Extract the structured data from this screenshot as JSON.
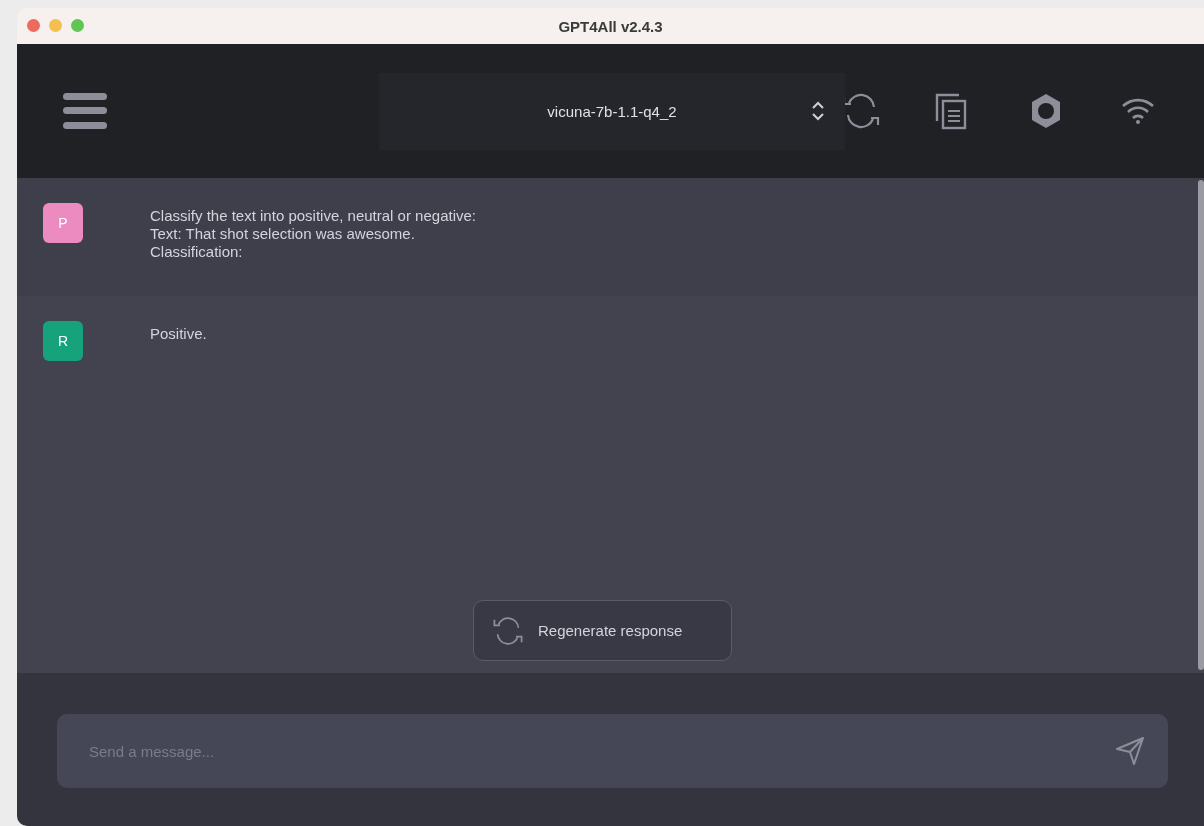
{
  "window": {
    "title": "GPT4All v2.4.3"
  },
  "toolbar": {
    "model": "vicuna-7b-1.1-q4_2"
  },
  "messages": [
    {
      "kind": "prompt",
      "avatar": "P",
      "color": "#ec8bbf",
      "text": "Classify the text into positive, neutral or negative:\nText: That shot selection was awesome.\nClassification:"
    },
    {
      "kind": "response",
      "avatar": "R",
      "color": "#16a37c",
      "text": "Positive."
    }
  ],
  "regenerate_button": "Regenerate response",
  "input": {
    "placeholder": "Send a message..."
  }
}
